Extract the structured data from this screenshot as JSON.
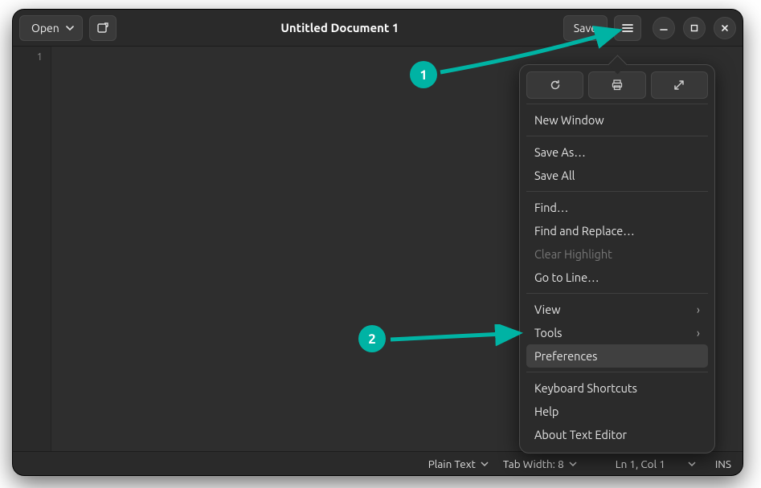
{
  "header": {
    "open_label": "Open",
    "title": "Untitled Document 1",
    "save_label": "Save"
  },
  "gutter": {
    "lines": [
      "1"
    ]
  },
  "menu": {
    "new_window": "New Window",
    "save_as": "Save As…",
    "save_all": "Save All",
    "find": "Find…",
    "find_replace": "Find and Replace…",
    "clear_highlight": "Clear Highlight",
    "goto_line": "Go to Line…",
    "view": "View",
    "tools": "Tools",
    "preferences": "Preferences",
    "shortcuts": "Keyboard Shortcuts",
    "help": "Help",
    "about": "About Text Editor"
  },
  "status": {
    "lang": "Plain Text",
    "tab_width": "Tab Width: 8",
    "cursor": "Ln 1, Col 1",
    "insert_mode": "INS"
  },
  "annotations": {
    "one": "1",
    "two": "2"
  },
  "colors": {
    "accent": "#00b3a4"
  }
}
